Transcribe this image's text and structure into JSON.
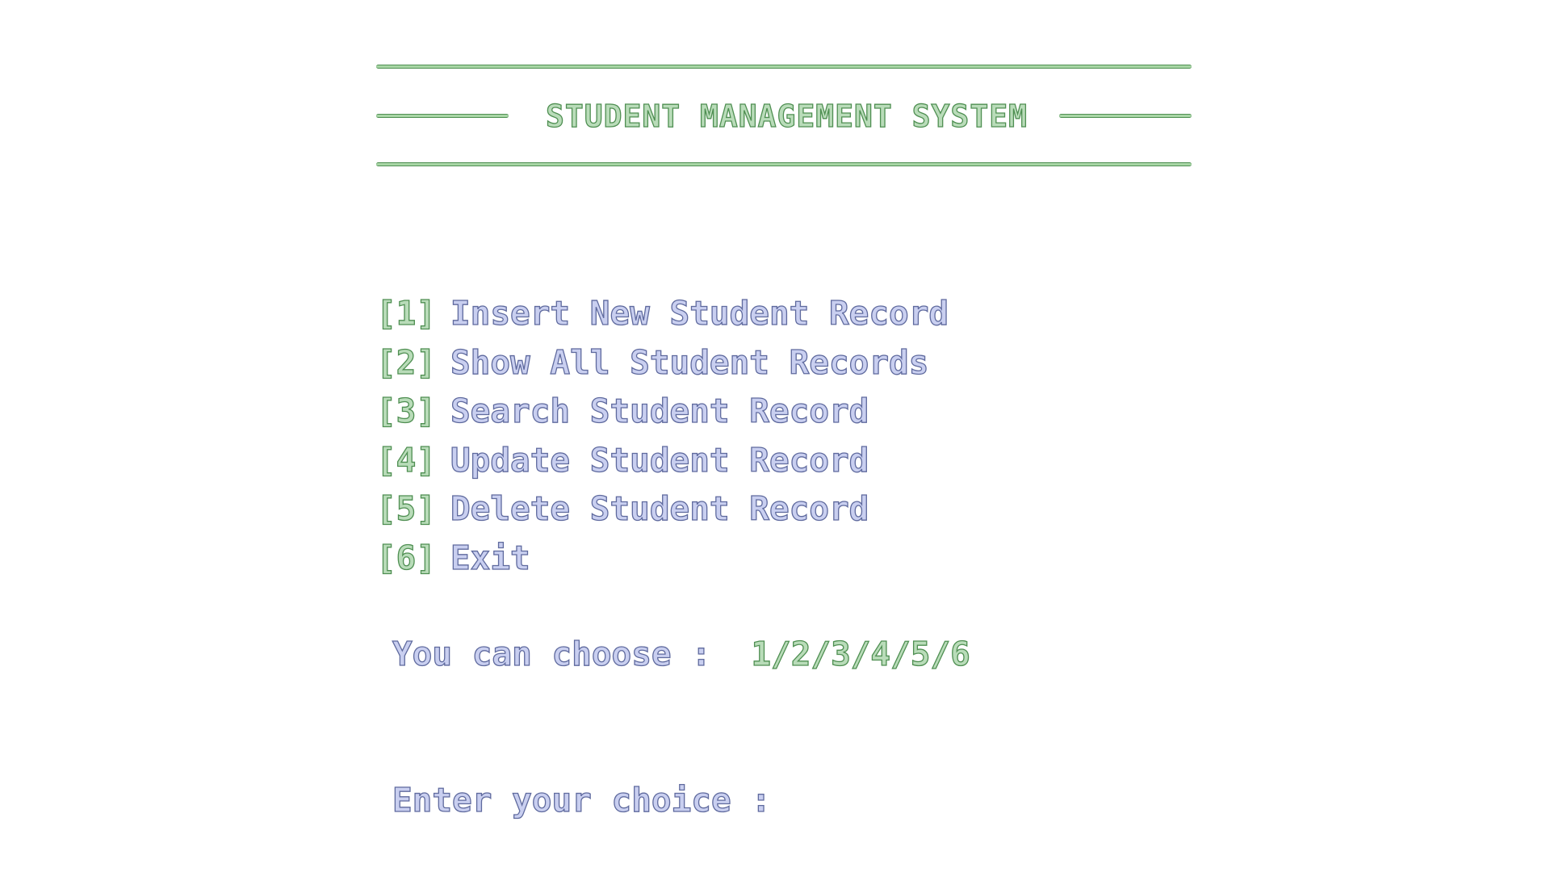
{
  "header": {
    "title": "STUDENT MANAGEMENT SYSTEM"
  },
  "menu": {
    "items": [
      {
        "key": "[1]",
        "label": "Insert New Student Record"
      },
      {
        "key": "[2]",
        "label": "Show All Student Records"
      },
      {
        "key": "[3]",
        "label": "Search Student Record"
      },
      {
        "key": "[4]",
        "label": "Update Student Record"
      },
      {
        "key": "[5]",
        "label": "Delete Student Record"
      },
      {
        "key": "[6]",
        "label": "Exit"
      }
    ]
  },
  "hint": {
    "label": "You can choose :",
    "options": "1/2/3/4/5/6"
  },
  "prompt": {
    "label": "Enter your choice :",
    "value": ""
  },
  "colors": {
    "accent_green": "#4f8f52",
    "text_blue": "#5f6a9e",
    "background": "#ffffff"
  }
}
